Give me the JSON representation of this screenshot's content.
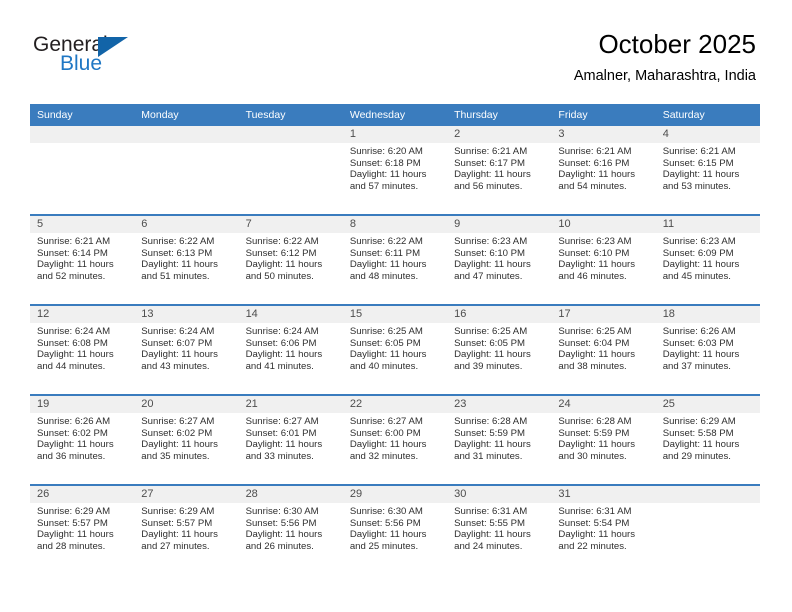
{
  "brand": {
    "name_top": "General",
    "name_bottom": "Blue",
    "triangle_icon": "blue-triangle-logo-icon",
    "color_dark": "#231f20",
    "color_blue": "#1f77c4"
  },
  "header": {
    "title": "October 2025",
    "subtitle": "Amalner, Maharashtra, India"
  },
  "theme": {
    "header_blue": "#3a7cbe",
    "daynum_band": "#f0f0f0",
    "text": "#2f2f2f"
  },
  "calendar": {
    "weekday_headers": [
      "Sunday",
      "Monday",
      "Tuesday",
      "Wednesday",
      "Thursday",
      "Friday",
      "Saturday"
    ],
    "weeks": [
      [
        {
          "day": "",
          "sunrise": "",
          "sunset": "",
          "daylight_line1": "",
          "daylight_line2": ""
        },
        {
          "day": "",
          "sunrise": "",
          "sunset": "",
          "daylight_line1": "",
          "daylight_line2": ""
        },
        {
          "day": "",
          "sunrise": "",
          "sunset": "",
          "daylight_line1": "",
          "daylight_line2": ""
        },
        {
          "day": "1",
          "sunrise": "Sunrise: 6:20 AM",
          "sunset": "Sunset: 6:18 PM",
          "daylight_line1": "Daylight: 11 hours",
          "daylight_line2": "and 57 minutes."
        },
        {
          "day": "2",
          "sunrise": "Sunrise: 6:21 AM",
          "sunset": "Sunset: 6:17 PM",
          "daylight_line1": "Daylight: 11 hours",
          "daylight_line2": "and 56 minutes."
        },
        {
          "day": "3",
          "sunrise": "Sunrise: 6:21 AM",
          "sunset": "Sunset: 6:16 PM",
          "daylight_line1": "Daylight: 11 hours",
          "daylight_line2": "and 54 minutes."
        },
        {
          "day": "4",
          "sunrise": "Sunrise: 6:21 AM",
          "sunset": "Sunset: 6:15 PM",
          "daylight_line1": "Daylight: 11 hours",
          "daylight_line2": "and 53 minutes."
        }
      ],
      [
        {
          "day": "5",
          "sunrise": "Sunrise: 6:21 AM",
          "sunset": "Sunset: 6:14 PM",
          "daylight_line1": "Daylight: 11 hours",
          "daylight_line2": "and 52 minutes."
        },
        {
          "day": "6",
          "sunrise": "Sunrise: 6:22 AM",
          "sunset": "Sunset: 6:13 PM",
          "daylight_line1": "Daylight: 11 hours",
          "daylight_line2": "and 51 minutes."
        },
        {
          "day": "7",
          "sunrise": "Sunrise: 6:22 AM",
          "sunset": "Sunset: 6:12 PM",
          "daylight_line1": "Daylight: 11 hours",
          "daylight_line2": "and 50 minutes."
        },
        {
          "day": "8",
          "sunrise": "Sunrise: 6:22 AM",
          "sunset": "Sunset: 6:11 PM",
          "daylight_line1": "Daylight: 11 hours",
          "daylight_line2": "and 48 minutes."
        },
        {
          "day": "9",
          "sunrise": "Sunrise: 6:23 AM",
          "sunset": "Sunset: 6:10 PM",
          "daylight_line1": "Daylight: 11 hours",
          "daylight_line2": "and 47 minutes."
        },
        {
          "day": "10",
          "sunrise": "Sunrise: 6:23 AM",
          "sunset": "Sunset: 6:10 PM",
          "daylight_line1": "Daylight: 11 hours",
          "daylight_line2": "and 46 minutes."
        },
        {
          "day": "11",
          "sunrise": "Sunrise: 6:23 AM",
          "sunset": "Sunset: 6:09 PM",
          "daylight_line1": "Daylight: 11 hours",
          "daylight_line2": "and 45 minutes."
        }
      ],
      [
        {
          "day": "12",
          "sunrise": "Sunrise: 6:24 AM",
          "sunset": "Sunset: 6:08 PM",
          "daylight_line1": "Daylight: 11 hours",
          "daylight_line2": "and 44 minutes."
        },
        {
          "day": "13",
          "sunrise": "Sunrise: 6:24 AM",
          "sunset": "Sunset: 6:07 PM",
          "daylight_line1": "Daylight: 11 hours",
          "daylight_line2": "and 43 minutes."
        },
        {
          "day": "14",
          "sunrise": "Sunrise: 6:24 AM",
          "sunset": "Sunset: 6:06 PM",
          "daylight_line1": "Daylight: 11 hours",
          "daylight_line2": "and 41 minutes."
        },
        {
          "day": "15",
          "sunrise": "Sunrise: 6:25 AM",
          "sunset": "Sunset: 6:05 PM",
          "daylight_line1": "Daylight: 11 hours",
          "daylight_line2": "and 40 minutes."
        },
        {
          "day": "16",
          "sunrise": "Sunrise: 6:25 AM",
          "sunset": "Sunset: 6:05 PM",
          "daylight_line1": "Daylight: 11 hours",
          "daylight_line2": "and 39 minutes."
        },
        {
          "day": "17",
          "sunrise": "Sunrise: 6:25 AM",
          "sunset": "Sunset: 6:04 PM",
          "daylight_line1": "Daylight: 11 hours",
          "daylight_line2": "and 38 minutes."
        },
        {
          "day": "18",
          "sunrise": "Sunrise: 6:26 AM",
          "sunset": "Sunset: 6:03 PM",
          "daylight_line1": "Daylight: 11 hours",
          "daylight_line2": "and 37 minutes."
        }
      ],
      [
        {
          "day": "19",
          "sunrise": "Sunrise: 6:26 AM",
          "sunset": "Sunset: 6:02 PM",
          "daylight_line1": "Daylight: 11 hours",
          "daylight_line2": "and 36 minutes."
        },
        {
          "day": "20",
          "sunrise": "Sunrise: 6:27 AM",
          "sunset": "Sunset: 6:02 PM",
          "daylight_line1": "Daylight: 11 hours",
          "daylight_line2": "and 35 minutes."
        },
        {
          "day": "21",
          "sunrise": "Sunrise: 6:27 AM",
          "sunset": "Sunset: 6:01 PM",
          "daylight_line1": "Daylight: 11 hours",
          "daylight_line2": "and 33 minutes."
        },
        {
          "day": "22",
          "sunrise": "Sunrise: 6:27 AM",
          "sunset": "Sunset: 6:00 PM",
          "daylight_line1": "Daylight: 11 hours",
          "daylight_line2": "and 32 minutes."
        },
        {
          "day": "23",
          "sunrise": "Sunrise: 6:28 AM",
          "sunset": "Sunset: 5:59 PM",
          "daylight_line1": "Daylight: 11 hours",
          "daylight_line2": "and 31 minutes."
        },
        {
          "day": "24",
          "sunrise": "Sunrise: 6:28 AM",
          "sunset": "Sunset: 5:59 PM",
          "daylight_line1": "Daylight: 11 hours",
          "daylight_line2": "and 30 minutes."
        },
        {
          "day": "25",
          "sunrise": "Sunrise: 6:29 AM",
          "sunset": "Sunset: 5:58 PM",
          "daylight_line1": "Daylight: 11 hours",
          "daylight_line2": "and 29 minutes."
        }
      ],
      [
        {
          "day": "26",
          "sunrise": "Sunrise: 6:29 AM",
          "sunset": "Sunset: 5:57 PM",
          "daylight_line1": "Daylight: 11 hours",
          "daylight_line2": "and 28 minutes."
        },
        {
          "day": "27",
          "sunrise": "Sunrise: 6:29 AM",
          "sunset": "Sunset: 5:57 PM",
          "daylight_line1": "Daylight: 11 hours",
          "daylight_line2": "and 27 minutes."
        },
        {
          "day": "28",
          "sunrise": "Sunrise: 6:30 AM",
          "sunset": "Sunset: 5:56 PM",
          "daylight_line1": "Daylight: 11 hours",
          "daylight_line2": "and 26 minutes."
        },
        {
          "day": "29",
          "sunrise": "Sunrise: 6:30 AM",
          "sunset": "Sunset: 5:56 PM",
          "daylight_line1": "Daylight: 11 hours",
          "daylight_line2": "and 25 minutes."
        },
        {
          "day": "30",
          "sunrise": "Sunrise: 6:31 AM",
          "sunset": "Sunset: 5:55 PM",
          "daylight_line1": "Daylight: 11 hours",
          "daylight_line2": "and 24 minutes."
        },
        {
          "day": "31",
          "sunrise": "Sunrise: 6:31 AM",
          "sunset": "Sunset: 5:54 PM",
          "daylight_line1": "Daylight: 11 hours",
          "daylight_line2": "and 22 minutes."
        },
        {
          "day": "",
          "sunrise": "",
          "sunset": "",
          "daylight_line1": "",
          "daylight_line2": ""
        }
      ]
    ]
  }
}
